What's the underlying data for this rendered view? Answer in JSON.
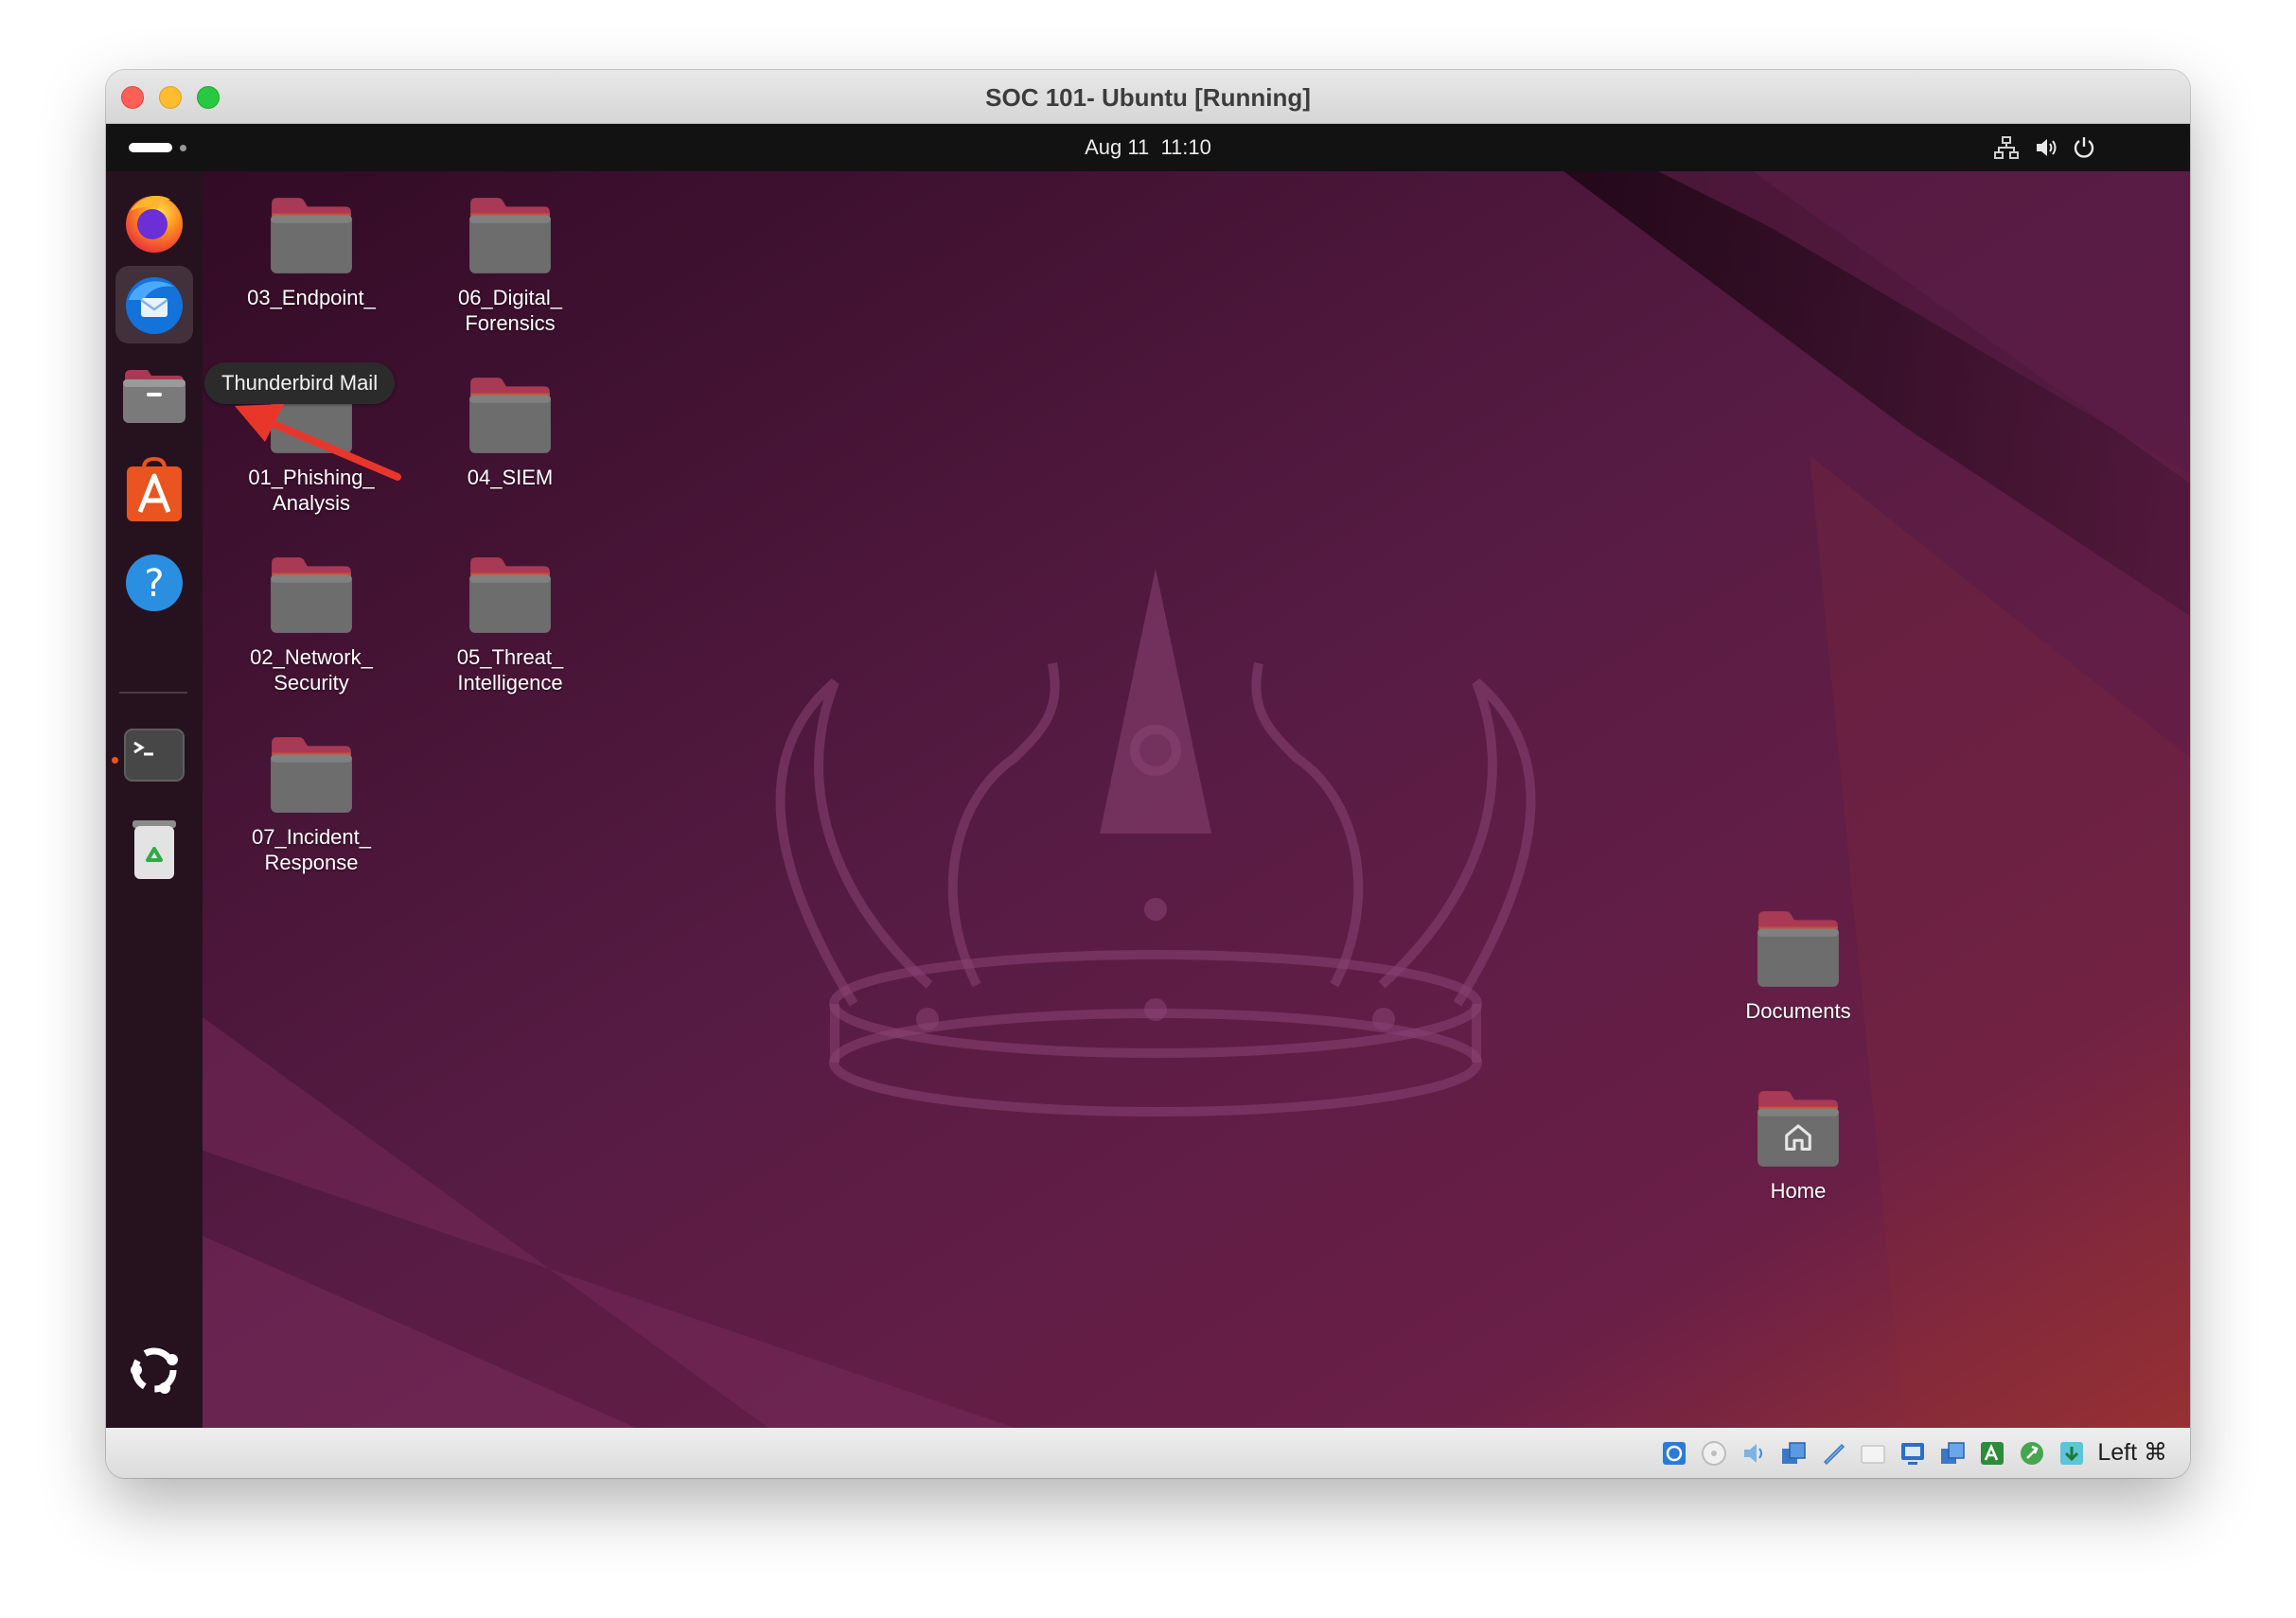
{
  "window": {
    "title": "SOC 101- Ubuntu [Running]"
  },
  "topbar": {
    "date": "Aug 11",
    "time": "11:10",
    "tray_icons": [
      "network-icon",
      "volume-icon",
      "power-icon"
    ]
  },
  "dock": {
    "items": [
      {
        "name": "Firefox",
        "icon": "firefox-icon"
      },
      {
        "name": "Thunderbird Mail",
        "icon": "thunderbird-icon",
        "active": true
      },
      {
        "name": "Files",
        "icon": "files-icon"
      },
      {
        "name": "App Center",
        "icon": "app-center-icon"
      },
      {
        "name": "Help",
        "icon": "help-icon"
      },
      {
        "name": "Terminal",
        "icon": "terminal-icon",
        "running": true
      },
      {
        "name": "Trash",
        "icon": "trash-icon"
      },
      {
        "name": "Show Apps",
        "icon": "ubuntu-logo-icon"
      }
    ]
  },
  "tooltip": {
    "text": "Thunderbird Mail"
  },
  "desktop": {
    "folders": [
      {
        "line1": "03_Endpoint_",
        "line2": ""
      },
      {
        "line1": "06_Digital_",
        "line2": "Forensics"
      },
      {
        "line1": "01_Phishing_",
        "line2": "Analysis"
      },
      {
        "line1": "04_SIEM",
        "line2": ""
      },
      {
        "line1": "02_Network_",
        "line2": "Security"
      },
      {
        "line1": "05_Threat_",
        "line2": "Intelligence"
      },
      {
        "line1": "07_Incident_",
        "line2": "Response"
      },
      {
        "line1": "Documents",
        "line2": ""
      },
      {
        "line1": "Home",
        "line2": ""
      }
    ]
  },
  "statusbar": {
    "host_key": "Left ⌘",
    "icons": [
      "hard-disk-icon",
      "optical-disc-icon",
      "audio-icon",
      "network-adapter-icon",
      "usb-icon",
      "shared-folder-icon",
      "display-icon",
      "recording-icon",
      "cpu-icon",
      "mouse-integration-icon",
      "keyboard-icon"
    ]
  },
  "colors": {
    "ubuntu_orange": "#e95420",
    "wallpaper_base": "#3a0e2c",
    "annotation_arrow": "#e8372a"
  }
}
